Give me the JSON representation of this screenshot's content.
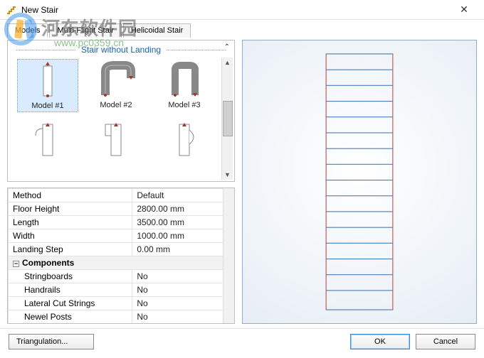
{
  "window": {
    "title": "New Stair"
  },
  "watermark": {
    "text": "河东软件园",
    "url": "www.pc0359.cn"
  },
  "tabs": [
    {
      "label": "Models",
      "active": true
    },
    {
      "label": "Multi-Flight Stair",
      "active": false
    },
    {
      "label": "Helicoidal Stair",
      "active": false
    }
  ],
  "gallery": {
    "group": "Stair without Landing",
    "models": [
      {
        "label": "Model #1",
        "selected": true
      },
      {
        "label": "Model #2",
        "selected": false
      },
      {
        "label": "Model #3",
        "selected": false
      }
    ]
  },
  "props": {
    "rows": [
      {
        "k": "Method",
        "v": "Default"
      },
      {
        "k": "Floor Height",
        "v": "2800.00 mm"
      },
      {
        "k": "Length",
        "v": "3500.00 mm"
      },
      {
        "k": "Width",
        "v": "1000.00 mm"
      },
      {
        "k": "Landing Step",
        "v": "0.00 mm"
      }
    ],
    "group": "Components",
    "children": [
      {
        "k": "Stringboards",
        "v": "No"
      },
      {
        "k": "Handrails",
        "v": "No"
      },
      {
        "k": "Lateral Cut Strings",
        "v": "No"
      },
      {
        "k": "Newel Posts",
        "v": "No"
      }
    ]
  },
  "footer": {
    "triangulation": "Triangulation...",
    "ok": "OK",
    "cancel": "Cancel"
  }
}
